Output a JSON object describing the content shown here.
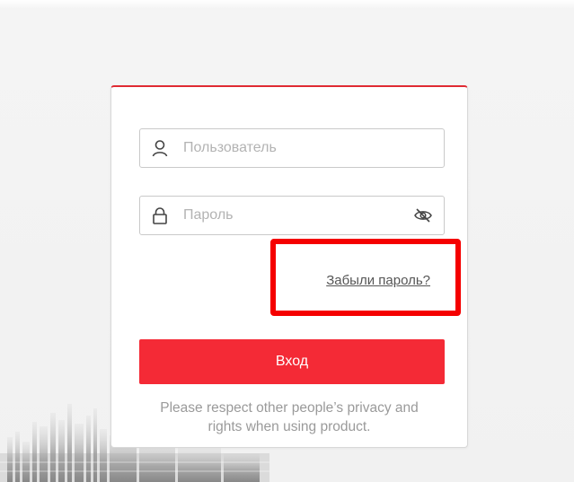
{
  "login": {
    "username_placeholder": "Пользователь",
    "username_value": "",
    "password_placeholder": "Пароль",
    "password_value": "",
    "forgot_password_label": "Забыли пароль?",
    "login_button_label": "Вход",
    "notice_line1": "Please respect other people’s privacy and",
    "notice_line2": "rights when using product."
  },
  "icons": {
    "username": "user-icon",
    "password": "lock-icon",
    "visibility": "eye-hidden-icon"
  },
  "colors": {
    "accent": "#f42a36",
    "highlight": "#f50000",
    "card_top_border": "#e02a33",
    "notice_text": "#9a9a9a"
  }
}
